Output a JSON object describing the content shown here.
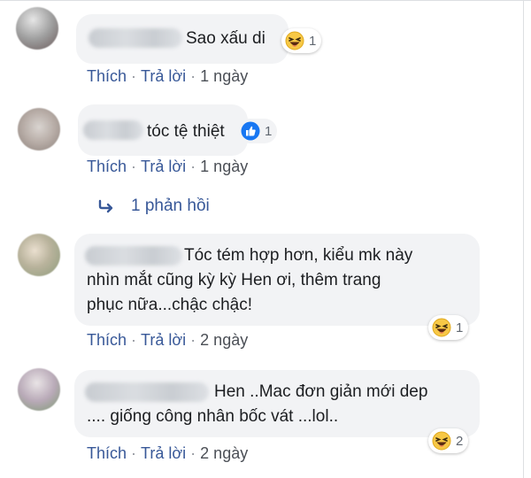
{
  "comments": [
    {
      "lines": [
        "Sao xấu di"
      ],
      "reaction": {
        "icon": "haha-emoji-icon",
        "count": "1"
      },
      "actions": {
        "like": "Thích",
        "reply": "Trả lời",
        "time": "1 ngày"
      }
    },
    {
      "lines": [
        "tóc tệ thiệt"
      ],
      "reaction": {
        "icon": "like-thumb-icon",
        "count": "1"
      },
      "actions": {
        "like": "Thích",
        "reply": "Trả lời",
        "time": "1 ngày"
      },
      "replies_label": "1 phản hồi"
    },
    {
      "lines": [
        "Tóc tém hợp hơn, kiểu mk này",
        "nhìn mắt cũng kỳ kỳ Hen ơi, thêm trang",
        "phục nữa...chậc chậc!"
      ],
      "reaction": {
        "icon": "haha-emoji-icon",
        "count": "1"
      },
      "actions": {
        "like": "Thích",
        "reply": "Trả lời",
        "time": "2 ngày"
      }
    },
    {
      "lines": [
        "Hen ..Mac đơn giản mới dep",
        ".... giống công nhân bốc vát ...lol.."
      ],
      "reaction": {
        "icon": "haha-emoji-icon",
        "count": "2"
      },
      "actions": {
        "like": "Thích",
        "reply": "Trả lời",
        "time": "2 ngày"
      }
    }
  ],
  "colors": {
    "bubble": "#f2f3f5",
    "link": "#385898",
    "text": "#1c1e21",
    "like_blue": "#1877f2",
    "haha_yellow": "#f7c846"
  }
}
